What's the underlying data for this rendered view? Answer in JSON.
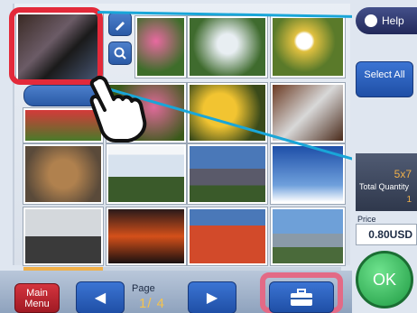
{
  "topbar": {
    "help_label": "Help"
  },
  "right_panel": {
    "select_all_label": "Select All",
    "size_value": "5x7",
    "total_quantity_label": "Total Quantity",
    "total_quantity_value": "1",
    "price_label": "Price",
    "price_value": "0.80USD",
    "ok_label": "OK"
  },
  "bottom": {
    "main_menu_label": "Main Menu",
    "page_label": "Page",
    "page_value": "1/ 4"
  },
  "colors": {
    "highlight": "#e32a3a",
    "accent": "#19a6d8",
    "ok_green": "#1e9a42"
  },
  "icons": [
    "pencil-icon",
    "zoom-icon",
    "toolbox-icon",
    "prev-arrow-icon",
    "next-arrow-icon",
    "pointing-hand-icon"
  ],
  "progress": {
    "fraction": 0.25
  }
}
